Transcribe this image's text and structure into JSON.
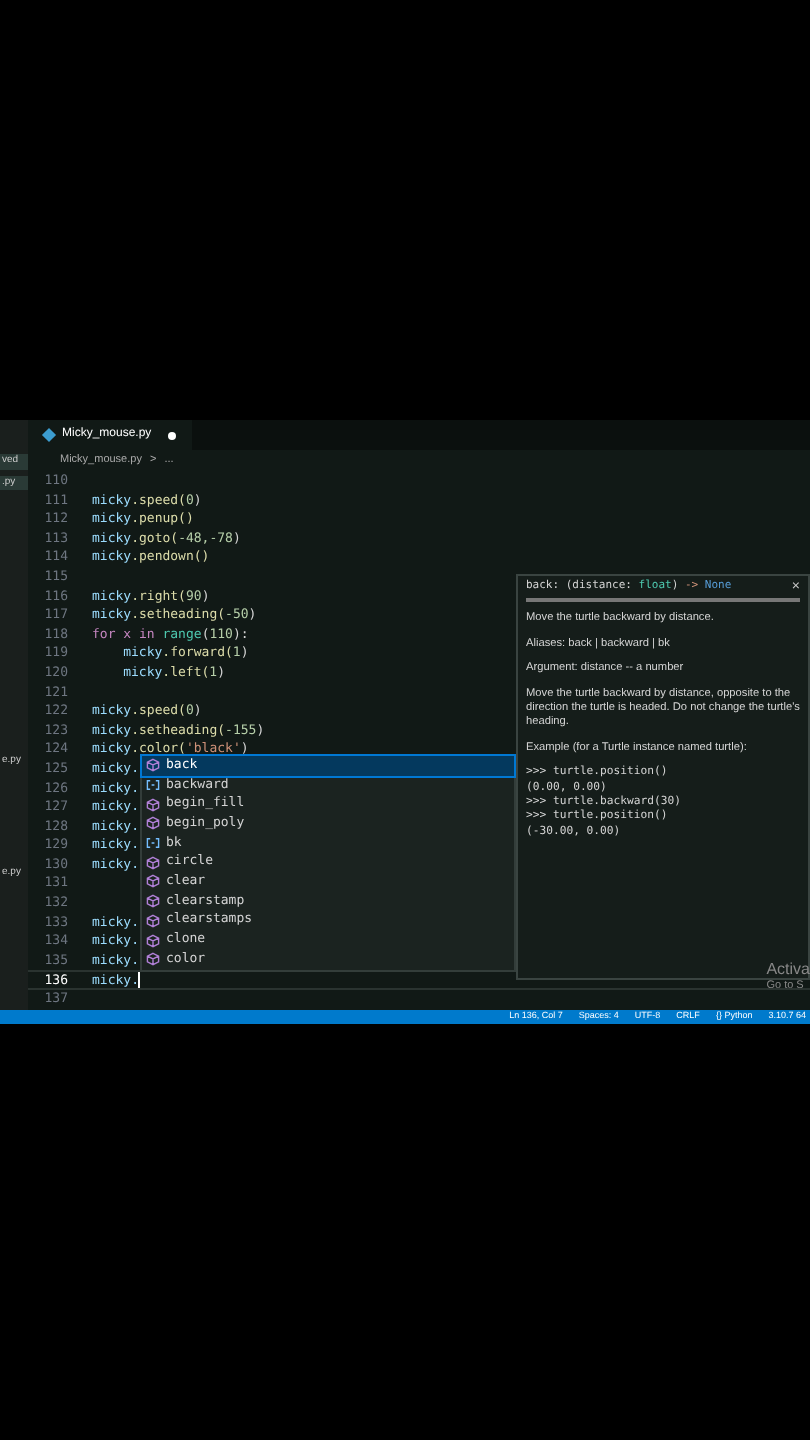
{
  "tab": {
    "title": "Micky_mouse.py",
    "modified": true
  },
  "breadcrumb": [
    "Micky_mouse.py",
    ">",
    "..."
  ],
  "sidebar": {
    "items": [
      "ved",
      ".py",
      "e.py",
      "e.py"
    ]
  },
  "lines": [
    {
      "number": "110"
    },
    {
      "number": "111",
      "code": [
        {
          "text": "micky",
          "kind": "var"
        },
        {
          "text": ".speed(",
          "kind": "fn"
        },
        {
          "text": "0",
          "kind": "num"
        },
        {
          "text": ")",
          "kind": "plain"
        }
      ]
    },
    {
      "number": "112",
      "code": [
        {
          "text": "micky",
          "kind": "var"
        },
        {
          "text": ".penup()",
          "kind": "fn"
        }
      ]
    },
    {
      "number": "113",
      "code": [
        {
          "text": "micky",
          "kind": "var"
        },
        {
          "text": ".goto(",
          "kind": "fn"
        },
        {
          "text": "-48,-78",
          "kind": "num"
        },
        {
          "text": ")",
          "kind": "plain"
        }
      ]
    },
    {
      "number": "114",
      "code": [
        {
          "text": "micky",
          "kind": "var"
        },
        {
          "text": ".pendown()",
          "kind": "fn"
        }
      ]
    },
    {
      "number": "115"
    },
    {
      "number": "116",
      "code": [
        {
          "text": "micky",
          "kind": "var"
        },
        {
          "text": ".right(",
          "kind": "fn"
        },
        {
          "text": "90",
          "kind": "num"
        },
        {
          "text": ")",
          "kind": "plain"
        }
      ]
    },
    {
      "number": "117",
      "code": [
        {
          "text": "micky",
          "kind": "var"
        },
        {
          "text": ".setheading(",
          "kind": "fn"
        },
        {
          "text": "-50",
          "kind": "num"
        },
        {
          "text": ")",
          "kind": "plain"
        }
      ]
    },
    {
      "number": "118",
      "code": [
        {
          "text": "for x in ",
          "kind": "kw"
        },
        {
          "text": "range",
          "kind": "type"
        },
        {
          "text": "(",
          "kind": "plain"
        },
        {
          "text": "110",
          "kind": "num"
        },
        {
          "text": "):",
          "kind": "plain"
        }
      ]
    },
    {
      "number": "119",
      "indented": true,
      "code": [
        {
          "text": "micky",
          "kind": "var"
        },
        {
          "text": ".forward(",
          "kind": "fn"
        },
        {
          "text": "1",
          "kind": "num"
        },
        {
          "text": ")",
          "kind": "plain"
        }
      ]
    },
    {
      "number": "120",
      "indented": true,
      "code": [
        {
          "text": "micky",
          "kind": "var"
        },
        {
          "text": ".left(",
          "kind": "fn"
        },
        {
          "text": "1",
          "kind": "num"
        },
        {
          "text": ")",
          "kind": "plain"
        }
      ]
    },
    {
      "number": "121"
    },
    {
      "number": "122",
      "code": [
        {
          "text": "micky",
          "kind": "var"
        },
        {
          "text": ".speed(",
          "kind": "fn"
        },
        {
          "text": "0",
          "kind": "num"
        },
        {
          "text": ")",
          "kind": "plain"
        }
      ]
    },
    {
      "number": "123",
      "code": [
        {
          "text": "micky",
          "kind": "var"
        },
        {
          "text": ".setheading(",
          "kind": "fn"
        },
        {
          "text": "-155",
          "kind": "num"
        },
        {
          "text": ")",
          "kind": "plain"
        }
      ]
    },
    {
      "number": "124",
      "code": [
        {
          "text": "micky",
          "kind": "var"
        },
        {
          "text": ".color(",
          "kind": "fn"
        },
        {
          "text": "'black'",
          "kind": "str"
        },
        {
          "text": ")",
          "kind": "plain"
        }
      ]
    },
    {
      "number": "125",
      "code": [
        {
          "text": "micky.",
          "kind": "var"
        }
      ]
    },
    {
      "number": "126",
      "code": [
        {
          "text": "micky.",
          "kind": "var"
        }
      ]
    },
    {
      "number": "127",
      "code": [
        {
          "text": "micky.",
          "kind": "var"
        }
      ]
    },
    {
      "number": "128",
      "code": [
        {
          "text": "micky.",
          "kind": "var"
        }
      ]
    },
    {
      "number": "129",
      "code": [
        {
          "text": "micky.",
          "kind": "var"
        }
      ]
    },
    {
      "number": "130",
      "code": [
        {
          "text": "micky.",
          "kind": "var"
        }
      ]
    },
    {
      "number": "131"
    },
    {
      "number": "132"
    },
    {
      "number": "133",
      "code": [
        {
          "text": "micky.",
          "kind": "var"
        }
      ]
    },
    {
      "number": "134",
      "code": [
        {
          "text": "micky.",
          "kind": "var"
        }
      ]
    },
    {
      "number": "135",
      "code": [
        {
          "text": "micky.",
          "kind": "var"
        }
      ]
    },
    {
      "number": "136",
      "code": [
        {
          "text": "micky.",
          "kind": "var"
        }
      ],
      "current": true
    },
    {
      "number": "137"
    }
  ],
  "suggestions": [
    {
      "label": "back",
      "kind": "method",
      "selected": true
    },
    {
      "label": "backward",
      "kind": "variable",
      "selected": false
    },
    {
      "label": "begin_fill",
      "kind": "method",
      "selected": false
    },
    {
      "label": "begin_poly",
      "kind": "method",
      "selected": false
    },
    {
      "label": "bk",
      "kind": "variable",
      "selected": false
    },
    {
      "label": "circle",
      "kind": "method",
      "selected": false
    },
    {
      "label": "clear",
      "kind": "method",
      "selected": false
    },
    {
      "label": "clearstamp",
      "kind": "method",
      "selected": false
    },
    {
      "label": "clearstamps",
      "kind": "method",
      "selected": false
    },
    {
      "label": "clone",
      "kind": "method",
      "selected": false
    },
    {
      "label": "color",
      "kind": "method",
      "selected": false
    }
  ],
  "hover": {
    "signature": [
      {
        "text": "back: (distance: ",
        "kind": "plain"
      },
      {
        "text": "float",
        "kind": "type"
      },
      {
        "text": ")",
        "kind": "plain"
      },
      {
        "text": " -> ",
        "kind": "arrow"
      },
      {
        "text": "None",
        "kind": "const"
      }
    ],
    "close": "×",
    "paragraphs": [
      "Move the turtle backward by distance.",
      "Aliases: back | backward | bk",
      "Argument: distance -- a number",
      "Move the turtle backward by distance, opposite to the direction the turtle is headed. Do not change the turtle's heading.",
      "Example (for a Turtle instance named turtle):"
    ],
    "example": [
      ">>> turtle.position()",
      "(0.00, 0.00)",
      ">>> turtle.backward(30)",
      ">>> turtle.position()",
      "(-30.00, 0.00)"
    ]
  },
  "activation": [
    "Activa",
    "Go to S"
  ],
  "status_bar": [
    "Ln 136, Col 7",
    "Spaces: 4",
    "UTF-8",
    "CRLF",
    "{} Python",
    "3.10.7 64"
  ]
}
